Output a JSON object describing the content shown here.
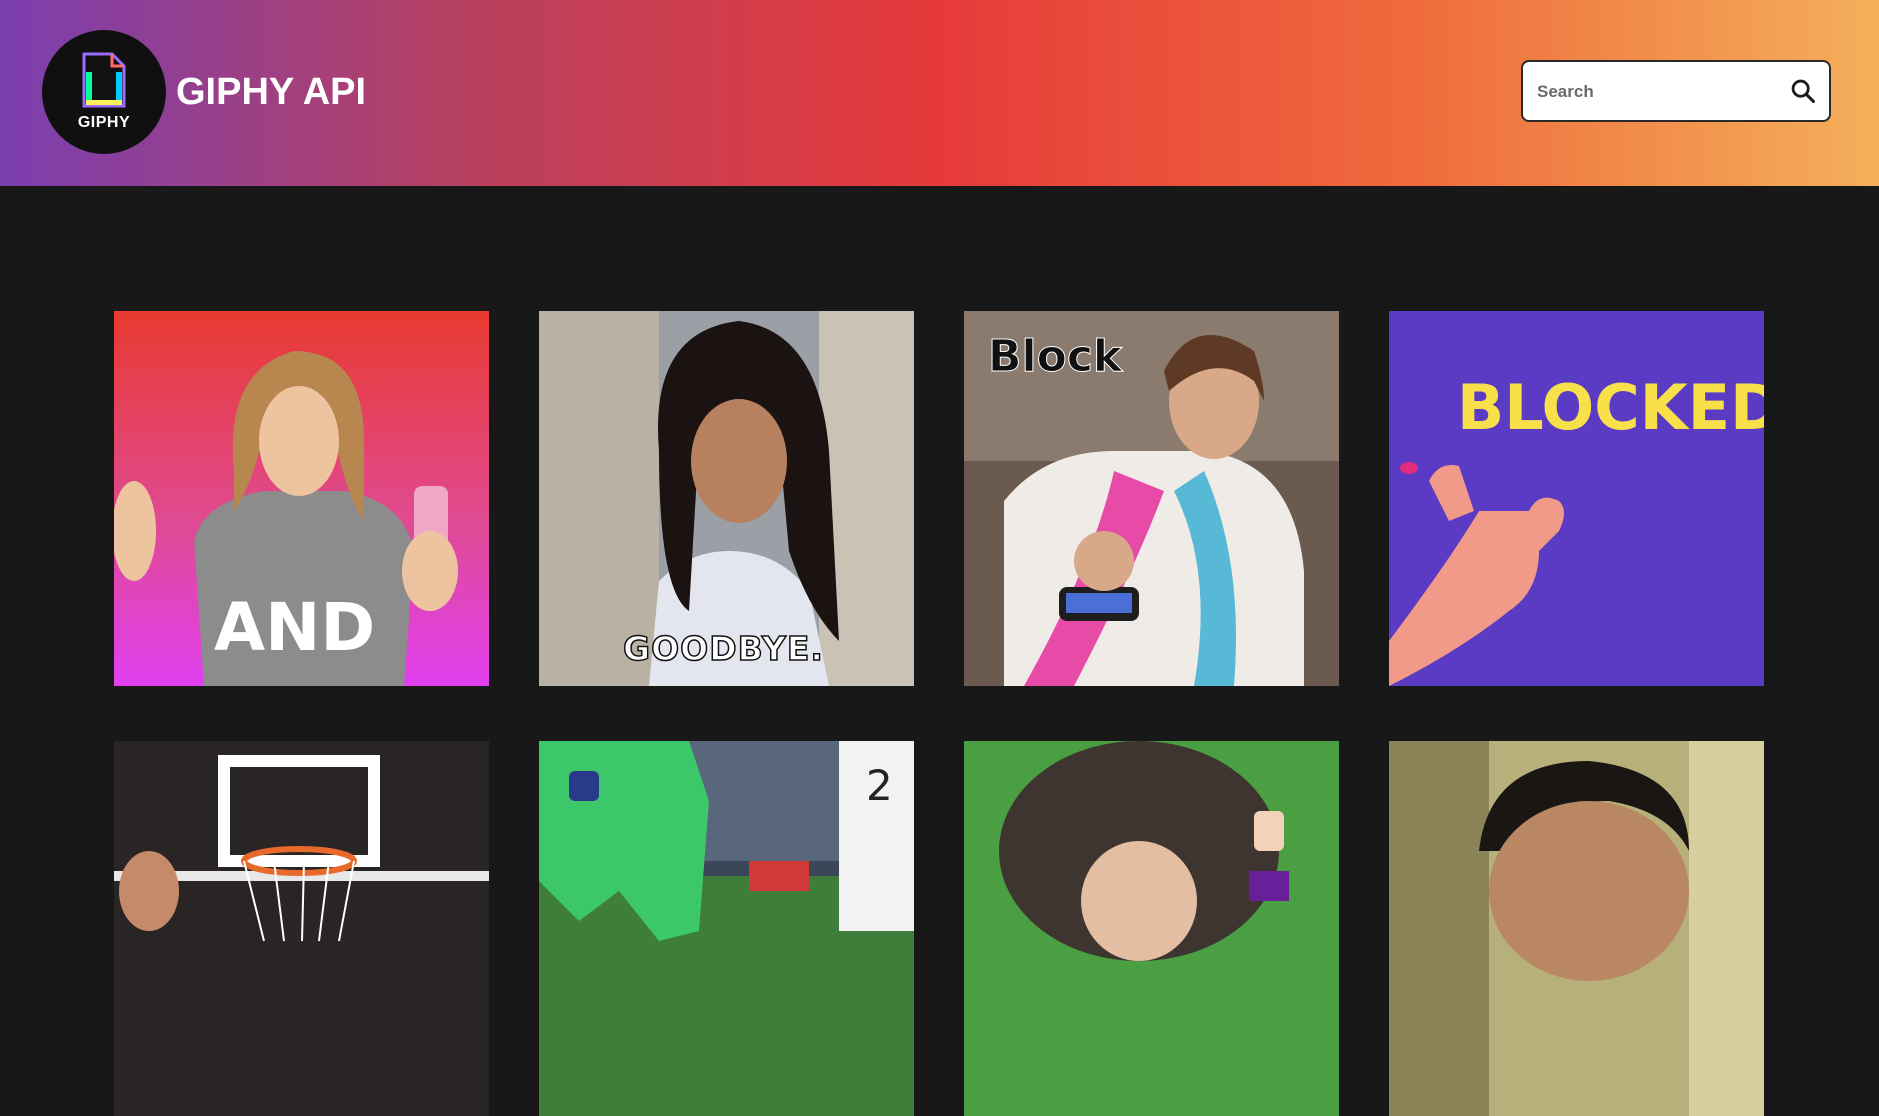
{
  "header": {
    "logo_text": "GIPHY",
    "title": "GIPHY API",
    "search": {
      "placeholder": "Search",
      "icon": "search-icon"
    }
  },
  "colors": {
    "gradient": [
      "#7b3fb0",
      "#e63a3a",
      "#f4b05a"
    ],
    "page_background": "#181818"
  },
  "gifs": [
    {
      "caption": "AND"
    },
    {
      "caption": "GOODBYE."
    },
    {
      "caption": "Block"
    },
    {
      "caption": "BLOCKED"
    },
    {
      "caption": ""
    },
    {
      "caption": "2"
    },
    {
      "caption": ""
    },
    {
      "caption": ""
    }
  ]
}
